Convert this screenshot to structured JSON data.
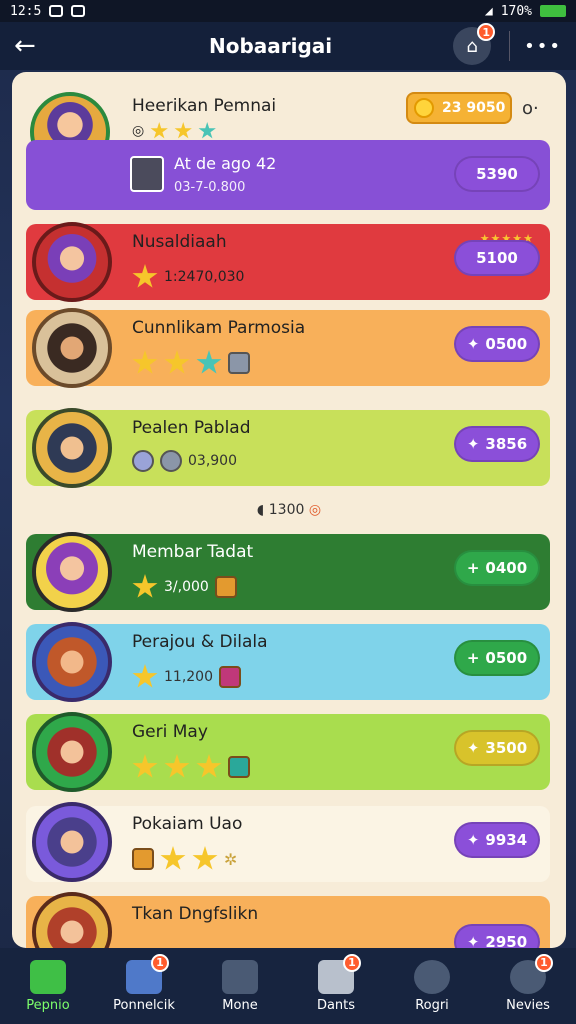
{
  "status_bar": {
    "time": "12:5",
    "battery": "170%"
  },
  "header": {
    "title": "Nobaarigai",
    "home_badge": "1"
  },
  "hero": {
    "name": "Heerikan Pemnai",
    "coins": "23 9050",
    "sub_title": "At de ago 42",
    "sub_value": "03-7-0.800",
    "sub_button": "5390"
  },
  "rows": [
    {
      "name": "Nusaldiaah",
      "stat": "1:2470,030",
      "button": "5100",
      "color": "#e03a3f",
      "button_color": "purple"
    },
    {
      "name": "Cunnlikam Parmosia",
      "stat": "",
      "button": "0500",
      "color": "#f8b05a",
      "button_color": "purple"
    },
    {
      "name": "Pealen Pablad",
      "stat": "03,900",
      "button": "3856",
      "color": "#c8e05a",
      "button_color": "purple"
    },
    {
      "name": "Membar Tadat",
      "stat": "3/,000",
      "button": "0400",
      "color": "#2e7d32",
      "button_color": "green"
    },
    {
      "name": "Perajou & Dilala",
      "stat": "11,200",
      "button": "0500",
      "color": "#7fd3ea",
      "button_color": "green"
    },
    {
      "name": "Geri May",
      "stat": "",
      "button": "3500",
      "color": "#a9dd4e",
      "button_color": "yellow"
    },
    {
      "name": "Pokaiam Uao",
      "stat": "",
      "button": "9934",
      "color": "#fbf4e4",
      "button_color": "purple"
    },
    {
      "name": "Tkan Dngfslikn",
      "stat": "",
      "button": "2950",
      "color": "#f8b05a",
      "button_color": "purple"
    }
  ],
  "divider_text": "1300",
  "nav": [
    {
      "label": "Pepnio",
      "badge": ""
    },
    {
      "label": "Ponnelcik",
      "badge": "1"
    },
    {
      "label": "Mone",
      "badge": ""
    },
    {
      "label": "Dants",
      "badge": "1"
    },
    {
      "label": "Rogri",
      "badge": ""
    },
    {
      "label": "Nevies",
      "badge": "1"
    }
  ]
}
